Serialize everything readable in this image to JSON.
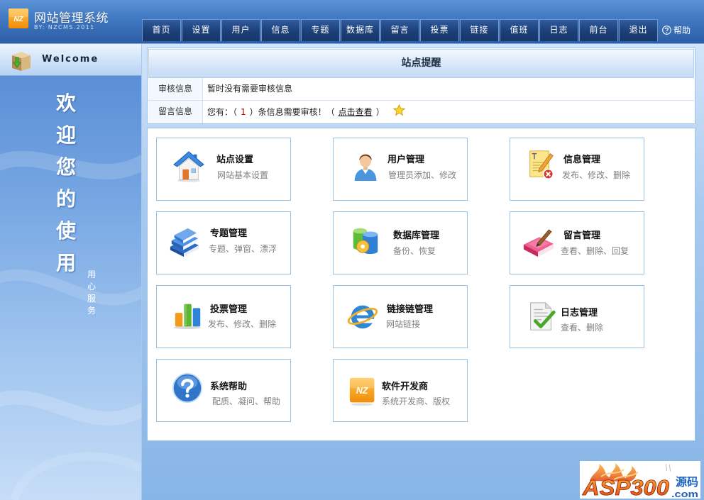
{
  "app": {
    "title": "网站管理系统",
    "subtitle": "BY: NZCMS.2011",
    "logo_text": "NZ"
  },
  "nav": {
    "items": [
      {
        "label": "首页"
      },
      {
        "label": "设置"
      },
      {
        "label": "用户"
      },
      {
        "label": "信息"
      },
      {
        "label": "专题"
      },
      {
        "label": "数据库"
      },
      {
        "label": "留言"
      },
      {
        "label": "投票"
      },
      {
        "label": "链接"
      },
      {
        "label": "值班"
      },
      {
        "label": "日志"
      },
      {
        "label": "前台"
      },
      {
        "label": "退出"
      }
    ],
    "help_label": "帮助",
    "help_icon": "help-circle-icon"
  },
  "sidebar": {
    "welcome": "Welcome",
    "welcome_icon": "box-download-icon",
    "slogan": "欢迎您的使用",
    "motto": "用心服务"
  },
  "notice": {
    "title": "站点提醒",
    "audit_label": "审核信息",
    "audit_text": "暂时没有需要审核信息",
    "message_label": "留言信息",
    "message_prefix": "您有：（",
    "message_count": "1",
    "message_middle": "）条信息需要审核！（",
    "message_link": "点击查看",
    "message_suffix": "）",
    "message_icon": "star-icon"
  },
  "modules": [
    {
      "title": "站点设置",
      "desc": "网站基本设置",
      "icon": "house-icon"
    },
    {
      "title": "用户管理",
      "desc": "管理员添加、修改",
      "icon": "user-icon"
    },
    {
      "title": "信息管理",
      "desc": "发布、修改、删除",
      "icon": "document-edit-icon"
    },
    {
      "title": "专题管理",
      "desc": "专题、弹窗、漂浮",
      "icon": "binder-icon"
    },
    {
      "title": "数据库管理",
      "desc": "备份、恢复",
      "icon": "database-icon"
    },
    {
      "title": "留言管理",
      "desc": "查看、删除、回复",
      "icon": "guestbook-icon"
    },
    {
      "title": "投票管理",
      "desc": "发布、修改、删除",
      "icon": "bar-chart-icon"
    },
    {
      "title": "链接链管理",
      "desc": "网站链接",
      "icon": "browser-e-icon"
    },
    {
      "title": "日志管理",
      "desc": "查看、删除",
      "icon": "checklist-icon"
    },
    {
      "title": "系统帮助",
      "desc": "配质、凝问、帮助",
      "icon": "help-icon"
    },
    {
      "title": "软件开发商",
      "desc": "系统开发商、版权",
      "icon": "nz-logo-icon"
    }
  ],
  "watermark": {
    "brand": "ASP300",
    "domain": ".com",
    "tag": "源码"
  },
  "colors": {
    "header": "#3c71bb",
    "nav_tab": "#1c3f77",
    "sidebar": "#77a7e3",
    "panel_border": "#9ec3ea",
    "card_border": "#96c3ea",
    "desc_text": "#808080",
    "logo_orange": "#f29a1f",
    "count_red": "#c00000"
  }
}
